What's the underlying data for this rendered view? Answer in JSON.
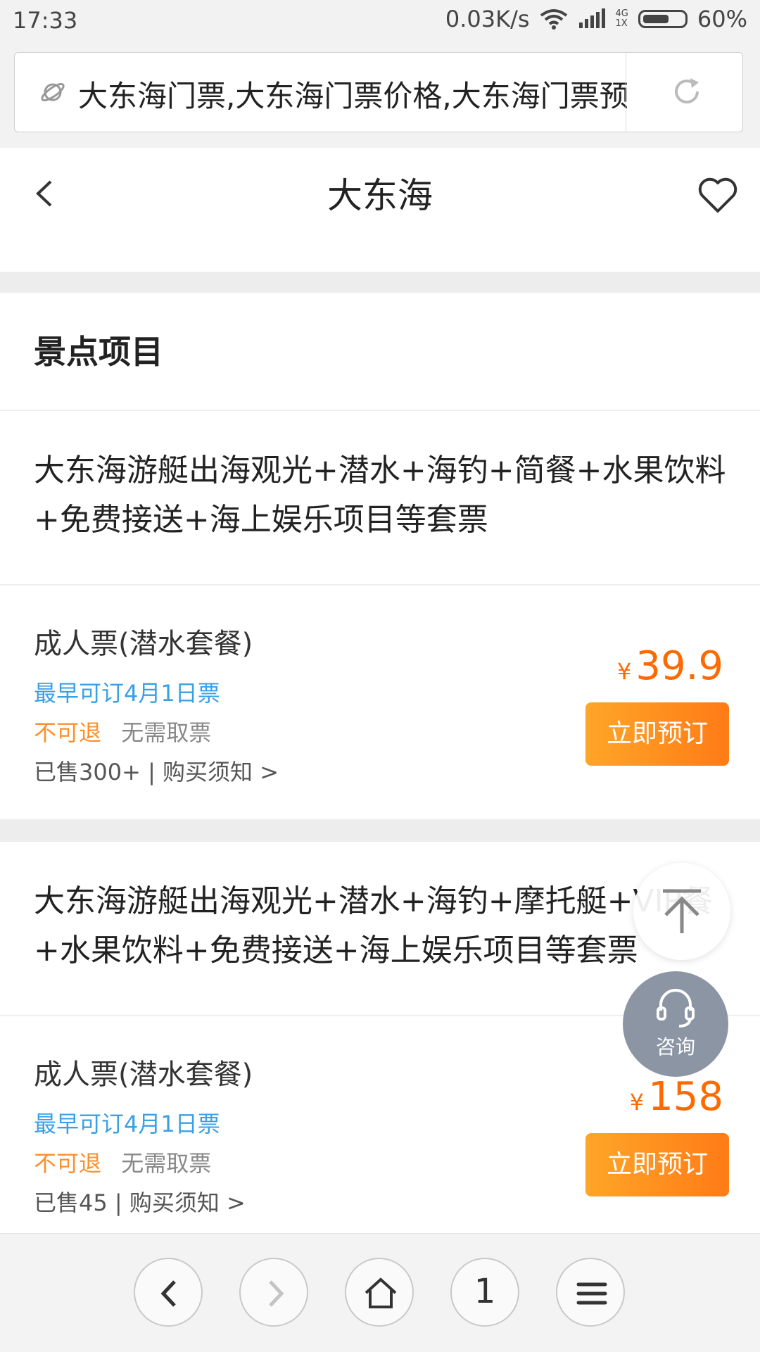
{
  "status_bar": {
    "time": "17:33",
    "speed": "0.03K/s",
    "network_top": "4G",
    "network_bottom": "1X",
    "battery": "60%"
  },
  "browser": {
    "url_text": "大东海门票,大东海门票价格,大东海门票预订"
  },
  "header": {
    "title": "大东海"
  },
  "section": {
    "title": "景点项目"
  },
  "packages": [
    {
      "title": "大东海游艇出海观光+潜水+海钓+简餐+水果饮料+免费接送+海上娱乐项目等套票",
      "ticket": {
        "name": "成人票(潜水套餐)",
        "earliest": "最早可订4月1日票",
        "refund": "不可退",
        "pickup": "无需取票",
        "sold": "已售300+ | 购买须知 >",
        "currency": "¥",
        "price": "39.9",
        "book_label": "立即预订"
      }
    },
    {
      "title": "大东海游艇出海观光+潜水+海钓+摩托艇+VIP餐+水果饮料+免费接送+海上娱乐项目等套票",
      "ticket": {
        "name": "成人票(潜水套餐)",
        "earliest": "最早可订4月1日票",
        "refund": "不可退",
        "pickup": "无需取票",
        "sold": "已售45 | 购买须知 >",
        "currency": "¥",
        "price": "158",
        "book_label": "立即预订"
      }
    }
  ],
  "floating": {
    "consult_label": "咨询"
  },
  "bottom_nav": {
    "tab_count": "1"
  },
  "colors": {
    "accent_orange": "#ff6a00",
    "link_blue": "#3aa0e6",
    "button_gradient_start": "#ffa628",
    "button_gradient_end": "#ff7b16"
  }
}
